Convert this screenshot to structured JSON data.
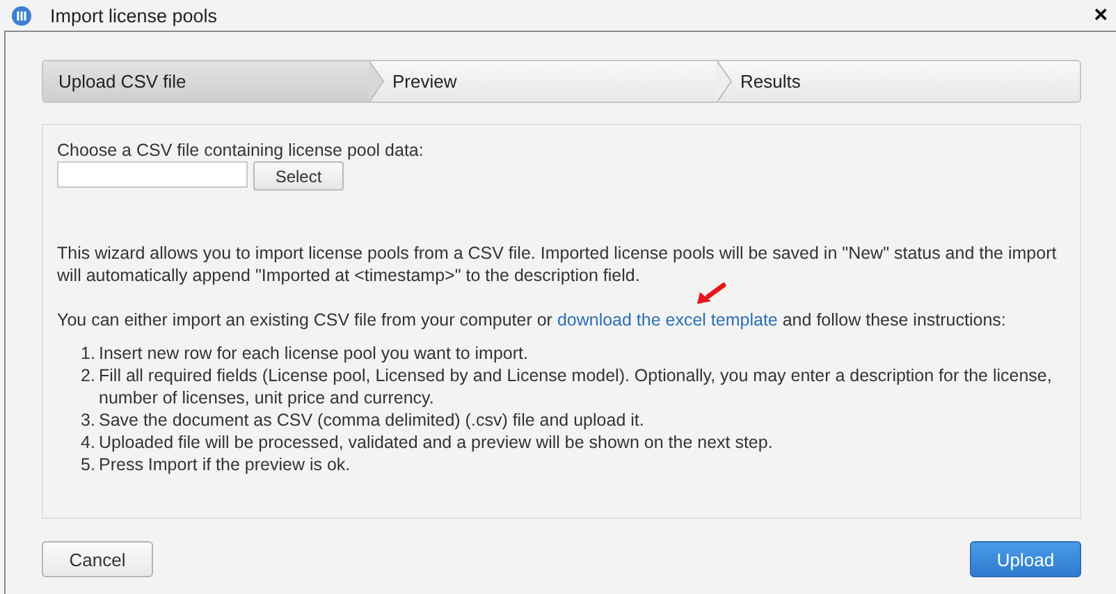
{
  "window": {
    "title": "Import license pools",
    "close_label": "×"
  },
  "steps": [
    {
      "label": "Upload CSV file",
      "selected": true
    },
    {
      "label": "Preview",
      "selected": false
    },
    {
      "label": "Results",
      "selected": false
    }
  ],
  "file_picker": {
    "label": "Choose a CSV file containing license pool data:",
    "button": "Select"
  },
  "intro": "This wizard allows you to import license pools from a CSV file. Imported license pools will be saved in \"New\" status and the import will automatically append \"Imported at <timestamp>\" to the description field.",
  "instructions": {
    "before": "You can either import an existing CSV file from your computer or",
    "link": "download the excel template",
    "after": "and follow these instructions:"
  },
  "list": [
    {
      "number": "1.",
      "text": "Insert new row for each license pool you want to import."
    },
    {
      "number": "2.",
      "text": "Fill all required fields (License pool, Licensed by and License model). Optionally, you may enter a description for the license, number of licenses, unit price and currency."
    },
    {
      "number": "3.",
      "text": "Save the document as CSV (comma delimited) (.csv) file and upload it."
    },
    {
      "number": "4.",
      "text": "Uploaded file will be processed, validated and a preview will be shown on the next step."
    },
    {
      "number": "5.",
      "text": "Press Import if the preview is ok."
    }
  ],
  "buttons": [
    {
      "label": "Cancel",
      "kind": "secondary"
    },
    {
      "label": "Upload",
      "kind": "primary"
    }
  ]
}
